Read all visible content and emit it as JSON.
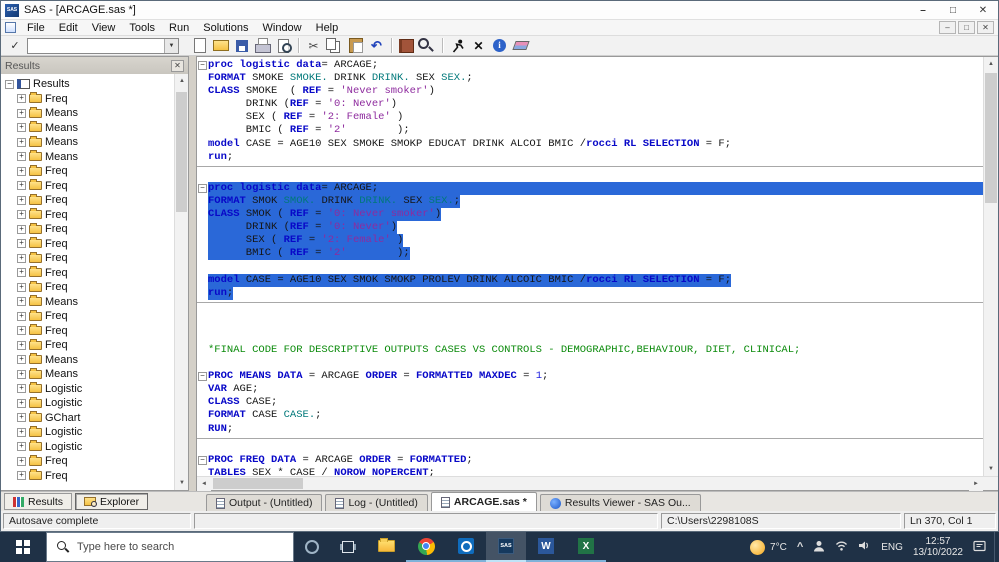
{
  "window": {
    "title": "SAS - [ARCAGE.sas *]"
  },
  "menu": {
    "items": [
      "File",
      "Edit",
      "View",
      "Tools",
      "Run",
      "Solutions",
      "Window",
      "Help"
    ]
  },
  "toolbar": {
    "command_value": "",
    "groups": [
      [
        "new-document-icon",
        "open-folder-icon",
        "save-icon",
        "print-icon",
        "print-preview-icon"
      ],
      [
        "cut-icon",
        "copy-icon",
        "paste-icon",
        "undo-icon"
      ],
      [
        "new-library-icon",
        "explorer-window-icon"
      ],
      [
        "submit-icon",
        "break-icon",
        "help-icon",
        "clear-all-icon"
      ]
    ]
  },
  "sidebar": {
    "header": "Results",
    "tree": [
      {
        "label": "Results",
        "root": true
      },
      {
        "label": "Freq"
      },
      {
        "label": "Means"
      },
      {
        "label": "Means"
      },
      {
        "label": "Means"
      },
      {
        "label": "Means"
      },
      {
        "label": "Freq"
      },
      {
        "label": "Freq"
      },
      {
        "label": "Freq"
      },
      {
        "label": "Freq"
      },
      {
        "label": "Freq"
      },
      {
        "label": "Freq"
      },
      {
        "label": "Freq"
      },
      {
        "label": "Freq"
      },
      {
        "label": "Freq"
      },
      {
        "label": "Means"
      },
      {
        "label": "Freq"
      },
      {
        "label": "Freq"
      },
      {
        "label": "Freq"
      },
      {
        "label": "Means"
      },
      {
        "label": "Means"
      },
      {
        "label": "Logistic"
      },
      {
        "label": "Logistic"
      },
      {
        "label": "GChart"
      },
      {
        "label": "Logistic"
      },
      {
        "label": "Logistic"
      },
      {
        "label": "Freq"
      },
      {
        "label": "Freq"
      }
    ],
    "tabs": [
      {
        "label": "Results",
        "icon": "results-tab-icon"
      },
      {
        "label": "Explorer",
        "icon": "explorer-tab-icon"
      }
    ]
  },
  "editor": {
    "lines": [
      {
        "box": true,
        "s": [
          [
            "kw",
            "proc logistic "
          ],
          [
            "kw",
            "data"
          ],
          [
            "id",
            "= ARCAGE;"
          ]
        ]
      },
      {
        "s": [
          [
            "kw",
            "FORMAT "
          ],
          [
            "id",
            "SMOKE "
          ],
          [
            "fmt",
            "SMOKE. "
          ],
          [
            "id",
            "DRINK "
          ],
          [
            "fmt",
            "DRINK. "
          ],
          [
            "id",
            "SEX "
          ],
          [
            "fmt",
            "SEX."
          ],
          [
            "id",
            ";"
          ]
        ]
      },
      {
        "s": [
          [
            "kw",
            "CLASS "
          ],
          [
            "id",
            "SMOKE  ( "
          ],
          [
            "kw",
            "REF"
          ],
          [
            "id",
            " = "
          ],
          [
            "str",
            "'Never smoker'"
          ],
          [
            "id",
            ")"
          ]
        ]
      },
      {
        "s": [
          [
            "id",
            "      DRINK ("
          ],
          [
            "kw",
            "REF"
          ],
          [
            "id",
            " = "
          ],
          [
            "str",
            "'0: Never'"
          ],
          [
            "id",
            ")"
          ]
        ]
      },
      {
        "s": [
          [
            "id",
            "      SEX ( "
          ],
          [
            "kw",
            "REF"
          ],
          [
            "id",
            " = "
          ],
          [
            "str",
            "'2: Female'"
          ],
          [
            "id",
            " )"
          ]
        ]
      },
      {
        "s": [
          [
            "id",
            "      BMIC ( "
          ],
          [
            "kw",
            "REF"
          ],
          [
            "id",
            " = "
          ],
          [
            "str",
            "'2'"
          ],
          [
            "id",
            "        );"
          ]
        ]
      },
      {
        "s": [
          [
            "kw",
            "model "
          ],
          [
            "id",
            "CASE = AGE10 SEX SMOKE SMOKP EDUCAT DRINK ALCOI BMIC /"
          ],
          [
            "kw",
            "rocci RL SELECTION"
          ],
          [
            "id",
            " = F;"
          ]
        ]
      },
      {
        "s": [
          [
            "kw",
            "run"
          ],
          [
            "id",
            ";"
          ]
        ]
      },
      {
        "d": true
      },
      {
        "s": []
      },
      {
        "box": true,
        "sel": true,
        "fw": true,
        "s": [
          [
            "kw",
            "proc logistic "
          ],
          [
            "kw",
            "data"
          ],
          [
            "id",
            "= ARCAGE;"
          ]
        ]
      },
      {
        "sel": true,
        "s": [
          [
            "kw",
            "FORMAT "
          ],
          [
            "id",
            "SMOK "
          ],
          [
            "fmt",
            "SMOK. "
          ],
          [
            "id",
            "DRINK "
          ],
          [
            "fmt",
            "DRINK. "
          ],
          [
            "id",
            "SEX "
          ],
          [
            "fmt",
            "SEX."
          ],
          [
            "id",
            ";"
          ]
        ]
      },
      {
        "sel": true,
        "s": [
          [
            "kw",
            "CLASS "
          ],
          [
            "id",
            "SMOK ( "
          ],
          [
            "kw",
            "REF"
          ],
          [
            "id",
            " = "
          ],
          [
            "str",
            "'0: Never smoker'"
          ],
          [
            "id",
            ")"
          ]
        ]
      },
      {
        "sel": true,
        "s": [
          [
            "id",
            "      DRINK ("
          ],
          [
            "kw",
            "REF"
          ],
          [
            "id",
            " = "
          ],
          [
            "str",
            "'0: Never'"
          ],
          [
            "id",
            ")"
          ]
        ]
      },
      {
        "sel": true,
        "s": [
          [
            "id",
            "      SEX ( "
          ],
          [
            "kw",
            "REF"
          ],
          [
            "id",
            " = "
          ],
          [
            "str",
            "'2: Female'"
          ],
          [
            "id",
            " )"
          ]
        ]
      },
      {
        "sel": true,
        "s": [
          [
            "id",
            "      BMIC ( "
          ],
          [
            "kw",
            "REF"
          ],
          [
            "id",
            " = "
          ],
          [
            "str",
            "'2'"
          ],
          [
            "id",
            "        );"
          ]
        ]
      },
      {
        "sel": true,
        "s": []
      },
      {
        "sel": true,
        "s": [
          [
            "kw",
            "model "
          ],
          [
            "id",
            "CASE = AGE10 SEX SMOK SMOKP PROLEV DRINK ALCOIC BMIC /"
          ],
          [
            "kw",
            "rocci RL SELECTION"
          ],
          [
            "id",
            " = F;"
          ]
        ]
      },
      {
        "sel": true,
        "s": [
          [
            "kw",
            "run"
          ],
          [
            "id",
            ";"
          ]
        ]
      },
      {
        "d": true
      },
      {
        "s": []
      },
      {
        "s": []
      },
      {
        "s": []
      },
      {
        "s": [
          [
            "cmt",
            "*FINAL CODE FOR DESCRIPTIVE OUTPUTS CASES VS CONTROLS - DEMOGRAPHIC,BEHAVIOUR, DIET, CLINICAL;"
          ]
        ]
      },
      {
        "s": []
      },
      {
        "box": true,
        "s": [
          [
            "kw",
            "PROC MEANS "
          ],
          [
            "kw",
            "DATA"
          ],
          [
            "id",
            " = ARCAGE "
          ],
          [
            "kw",
            "ORDER"
          ],
          [
            "id",
            " = "
          ],
          [
            "kw",
            "FORMATTED "
          ],
          [
            "kw",
            "MAXDEC"
          ],
          [
            "id",
            " = "
          ],
          [
            "num",
            "1"
          ],
          [
            "id",
            ";"
          ]
        ]
      },
      {
        "s": [
          [
            "kw",
            "VAR "
          ],
          [
            "id",
            "AGE;"
          ]
        ]
      },
      {
        "s": [
          [
            "kw",
            "CLASS "
          ],
          [
            "id",
            "CASE;"
          ]
        ]
      },
      {
        "s": [
          [
            "kw",
            "FORMAT "
          ],
          [
            "id",
            "CASE "
          ],
          [
            "fmt",
            "CASE."
          ],
          [
            "id",
            ";"
          ]
        ]
      },
      {
        "s": [
          [
            "kw",
            "RUN"
          ],
          [
            "id",
            ";"
          ]
        ]
      },
      {
        "d": true
      },
      {
        "s": []
      },
      {
        "box": true,
        "s": [
          [
            "kw",
            "PROC FREQ "
          ],
          [
            "kw",
            "DATA"
          ],
          [
            "id",
            " = ARCAGE "
          ],
          [
            "kw",
            "ORDER"
          ],
          [
            "id",
            " = "
          ],
          [
            "kw",
            "FORMATTED"
          ],
          [
            "id",
            ";"
          ]
        ]
      },
      {
        "s": [
          [
            "kw",
            "TABLES "
          ],
          [
            "id",
            "SEX * CASE / "
          ],
          [
            "kw",
            "NOROW NOPERCENT"
          ],
          [
            "id",
            ";"
          ]
        ]
      }
    ]
  },
  "window_bar": {
    "tabs": [
      {
        "label": "Output - (Untitled)",
        "icon": "output-doc-icon",
        "active": false
      },
      {
        "label": "Log - (Untitled)",
        "icon": "log-doc-icon",
        "active": false
      },
      {
        "label": "ARCAGE.sas *",
        "icon": "sas-program-icon",
        "active": true
      },
      {
        "label": "Results Viewer - SAS Ou...",
        "icon": "results-viewer-icon",
        "active": false
      }
    ]
  },
  "status_bar": {
    "left": "Autosave complete",
    "path": "C:\\Users\\2298108S",
    "position": "Ln 370, Col 1"
  },
  "taskbar": {
    "search_placeholder": "Type here to search",
    "weather": "7°C",
    "language": "ENG",
    "time": "12:57",
    "date": "13/10/2022"
  },
  "colors": {
    "selection": "#2a68d8",
    "keyword": "#0808c8",
    "format": "#00787a",
    "string": "#8e2b9e",
    "comment": "#0a8a0a",
    "taskbar": "#1f3146"
  }
}
